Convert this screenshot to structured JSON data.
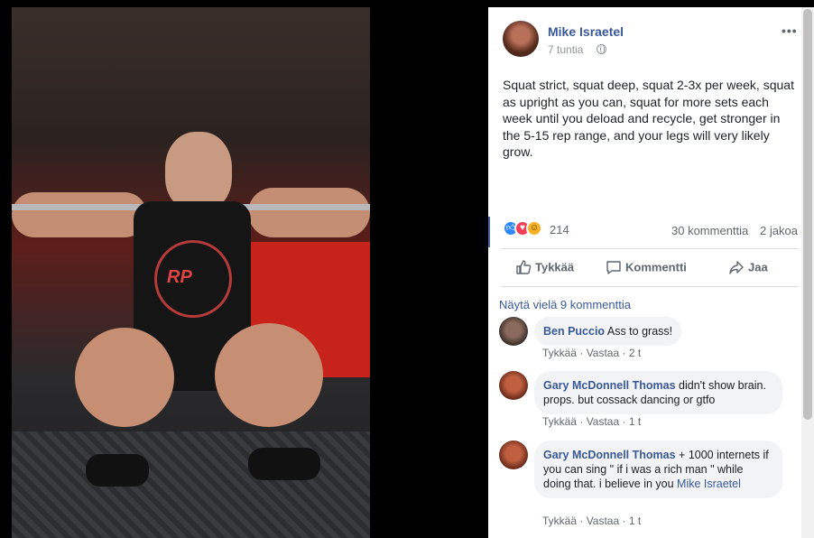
{
  "post": {
    "author": "Mike Israetel",
    "time": "7 tuntia",
    "text": "Squat strict, squat deep, squat 2-3x per week, squat as upright as you can, squat for more sets each week until you deload and recycle, get stronger in the 5-15 rep range, and your legs will very likely grow.",
    "reaction_count": "214",
    "comment_count": "30 kommenttia",
    "share_count": "2 jakoa"
  },
  "actions": {
    "like": "Tykkää",
    "comment": "Kommentti",
    "share": "Jaa"
  },
  "comments": {
    "more_label": "Näytä vielä 9 kommenttia",
    "items": [
      {
        "name": "Ben Puccio",
        "text": "Ass to grass!",
        "like": "Tykkää",
        "reply": "Vastaa",
        "time": "2 t"
      },
      {
        "name": "Gary McDonnell Thomas",
        "text": "didn't show brain. props. but cossack dancing or gtfo",
        "like": "Tykkää",
        "reply": "Vastaa",
        "time": "1 t"
      },
      {
        "name": "Gary McDonnell Thomas",
        "text": "+ 1000 internets if you can sing \" if i was a rich man \" while doing that. i believe in you",
        "mention": "Mike Israetel",
        "like": "Tykkää",
        "reply": "Vastaa",
        "time": "1 t"
      }
    ]
  },
  "photo": {
    "shirt_logo": "RP"
  },
  "colors": {
    "link": "#385898",
    "bubble": "#f2f3f5",
    "like_blue": "#2d88ff",
    "love_red": "#f33e58",
    "haha_yellow": "#f7b125"
  }
}
